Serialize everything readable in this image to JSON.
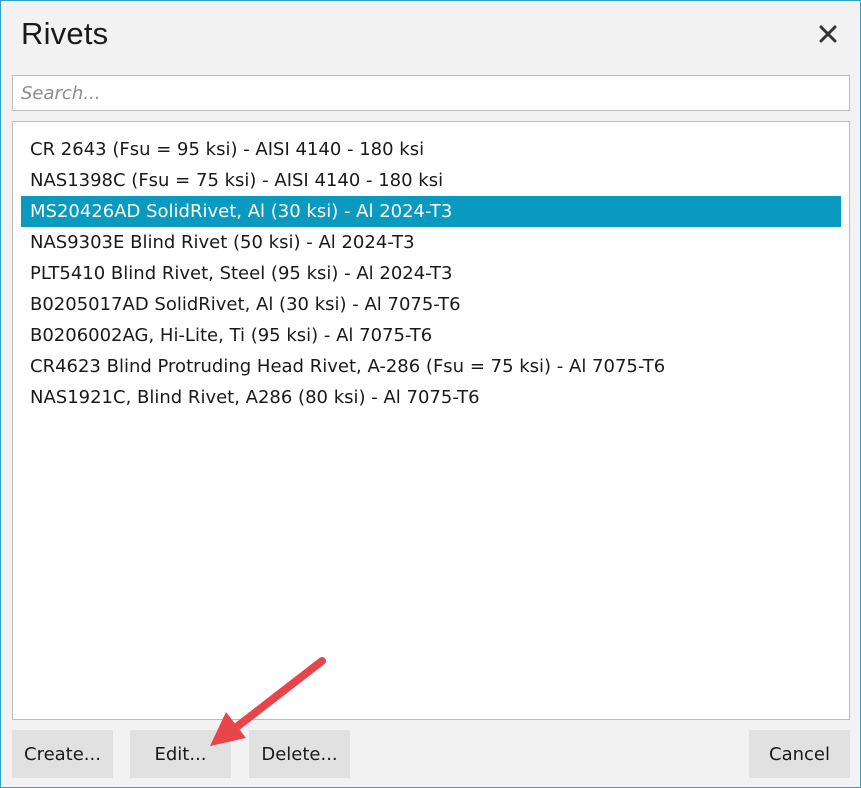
{
  "dialog": {
    "title": "Rivets",
    "close_icon": "close-icon"
  },
  "search": {
    "placeholder": "Search...",
    "value": ""
  },
  "rivets": [
    {
      "label": "CR 2643 (Fsu = 95 ksi) - AISI 4140 - 180 ksi",
      "selected": false
    },
    {
      "label": "NAS1398C (Fsu = 75 ksi) - AISI 4140 - 180 ksi",
      "selected": false
    },
    {
      "label": "MS20426AD SolidRivet, Al (30 ksi) - Al 2024-T3",
      "selected": true
    },
    {
      "label": "NAS9303E Blind Rivet (50 ksi) - Al 2024-T3",
      "selected": false
    },
    {
      "label": "PLT5410 Blind Rivet, Steel (95 ksi) - Al 2024-T3",
      "selected": false
    },
    {
      "label": "B0205017AD SolidRivet, Al (30 ksi) - Al 7075-T6",
      "selected": false
    },
    {
      "label": "B0206002AG, Hi-Lite, Ti (95 ksi) - Al 7075-T6",
      "selected": false
    },
    {
      "label": "CR4623 Blind Protruding Head Rivet, A-286 (Fsu = 75 ksi) - Al 7075-T6",
      "selected": false
    },
    {
      "label": "NAS1921C, Blind Rivet, A286 (80 ksi) - Al 7075-T6",
      "selected": false
    }
  ],
  "buttons": {
    "create": "Create...",
    "edit": "Edit...",
    "delete": "Delete...",
    "cancel": "Cancel"
  },
  "colors": {
    "selection": "#0a99bf",
    "annotation_arrow": "#e8454a",
    "window_border": "#2fa4c8"
  }
}
